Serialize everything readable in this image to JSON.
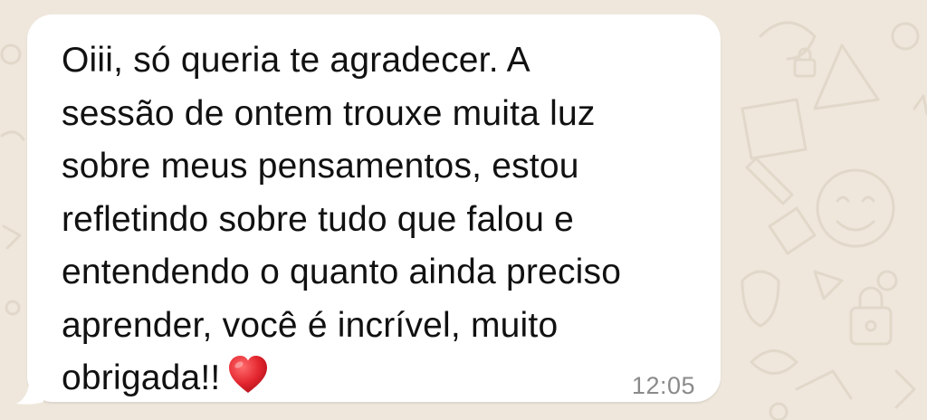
{
  "colors": {
    "chat_background": "#efe7dc",
    "doodle_color": "#e2d8ca",
    "bubble_background": "#ffffff",
    "message_text": "#111111",
    "timestamp_text": "#8a8a8a",
    "heart_color": "#e3262f"
  },
  "message": {
    "lines": [
      "Oiii, só queria te agradecer. A",
      "sessão de ontem trouxe muita luz",
      "sobre meus pensamentos, estou",
      "refletindo sobre tudo que falou e",
      "entendendo o quanto ainda preciso",
      "aprender, você é incrível, muito",
      "obrigada!!"
    ],
    "emoji": "heart-icon",
    "time": "12:05"
  }
}
